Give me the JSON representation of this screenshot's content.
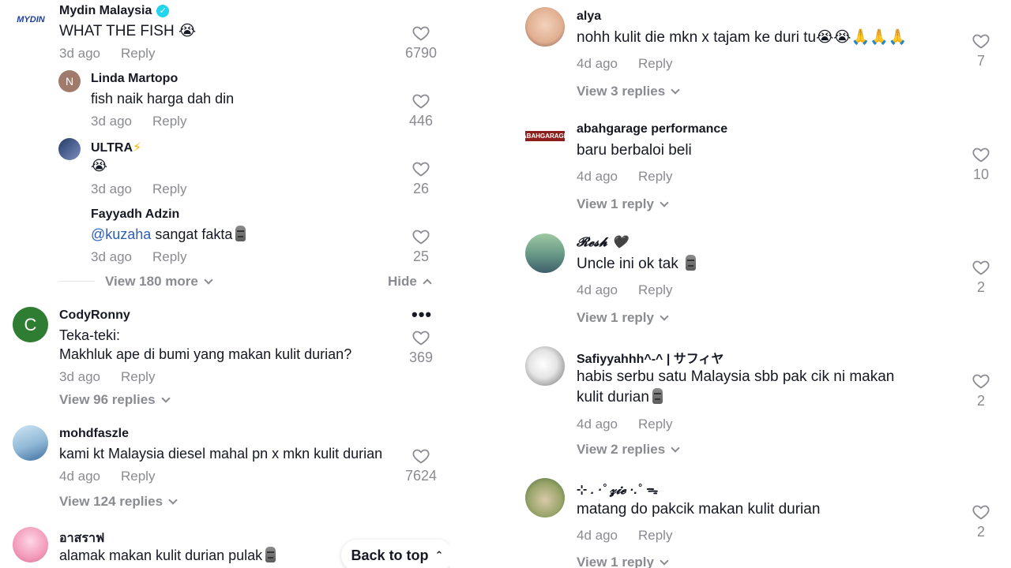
{
  "left": {
    "c1": {
      "user": "Mydin Malaysia",
      "text": "WHAT THE FISH",
      "time": "3d ago",
      "reply": "Reply",
      "likes": "6790",
      "logo": "MYDIN"
    },
    "r1": {
      "user": "Linda Martopo",
      "initial": "N",
      "text": "fish naik harga dah din",
      "time": "3d ago",
      "reply": "Reply",
      "likes": "446"
    },
    "r2": {
      "user": "ULTRA",
      "text": "😭",
      "time": "3d ago",
      "reply": "Reply",
      "likes": "26"
    },
    "r3": {
      "user": "Fayyadh Adzin",
      "mention": "@kuzaha",
      "text": " sangat fakta",
      "time": "3d ago",
      "reply": "Reply",
      "likes": "25"
    },
    "view_more": "View 180 more",
    "hide": "Hide",
    "c2": {
      "user": "CodyRonny",
      "initial": "C",
      "line1": "Teka-teki:",
      "line2": "Makhluk ape di bumi yang makan kulit durian?",
      "time": "3d ago",
      "reply": "Reply",
      "likes": "369",
      "replies": "View 96 replies"
    },
    "c3": {
      "user": "mohdfaszle",
      "text": "kami kt Malaysia diesel mahal pn x mkn kulit durian",
      "time": "4d ago",
      "reply": "Reply",
      "likes": "7624",
      "replies": "View 124 replies"
    },
    "c4": {
      "user": "อาสราฟ",
      "text": "alamak makan kulit durian pulak"
    },
    "back_to_top": "Back to top"
  },
  "right": {
    "c1": {
      "user": "alya",
      "text": "nohh kulit die mkn x tajam ke duri tu😭😭🙏🙏🙏",
      "time": "4d ago",
      "reply": "Reply",
      "likes": "7",
      "replies": "View 3 replies"
    },
    "c2": {
      "user": "abahgarage performance",
      "logo": "ABAHGARAGE",
      "text": "baru berbaloi beli",
      "time": "4d ago",
      "reply": "Reply",
      "likes": "10",
      "replies": "View 1 reply"
    },
    "c3": {
      "user": "𝓡𝓮𝓼𝓱 🖤",
      "text": "Uncle ini ok tak",
      "time": "4d ago",
      "reply": "Reply",
      "likes": "2",
      "replies": "View 1 reply"
    },
    "c4": {
      "user": "Safiyyahhh^-^ | サフィヤ",
      "line1": "habis serbu satu Malaysia sbb pak cik ni makan",
      "line2": "kulit durian",
      "time": "4d ago",
      "reply": "Reply",
      "likes": "2",
      "replies": "View 2 replies"
    },
    "c5": {
      "user": "⊹ . ·˚ 𝔃𝓲𝓮 ·.˚ ᯓ",
      "text": "matang do pakcik makan kulit durian",
      "time": "4d ago",
      "reply": "Reply",
      "likes": "2",
      "replies": "View 1 reply"
    }
  },
  "colors": {
    "text": "#161823",
    "muted": "#8a8b91",
    "mention": "#2b5db9",
    "verified": "#20d5ec"
  }
}
